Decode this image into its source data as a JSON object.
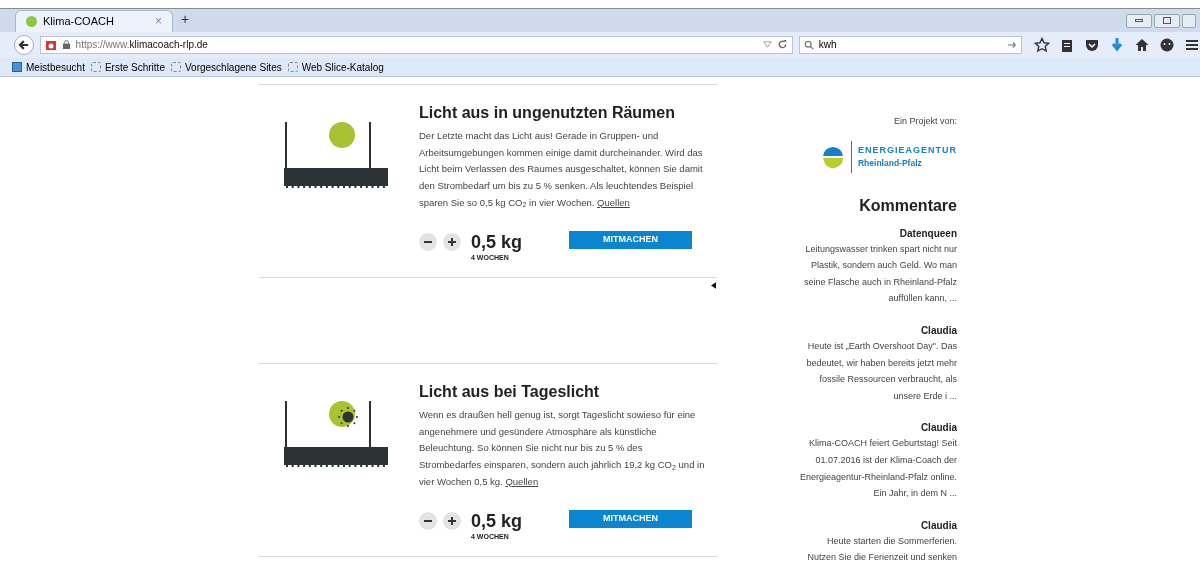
{
  "browser": {
    "tab": {
      "title": "Klima-COACH",
      "close": "×",
      "new_tab": "+"
    },
    "url": {
      "scheme": "https://www.",
      "domain": "klimacoach-rlp.de"
    },
    "search": {
      "value": "kwh"
    },
    "bookmarks": [
      {
        "label": "Meistbesucht",
        "kind": "special"
      },
      {
        "label": "Erste Schritte",
        "kind": "page"
      },
      {
        "label": "Vorgeschlagene Sites",
        "kind": "page"
      },
      {
        "label": "Web Slice-Katalog",
        "kind": "page"
      }
    ]
  },
  "cards": [
    {
      "kind": "bulb",
      "title": "Licht aus in ungenutzten Räumen",
      "body": "Der Letzte macht das Licht aus! Gerade in Gruppen- und Arbeitsumgebungen kommen einige damit durcheinander. Wird das Licht beim Verlassen des Raumes ausgeschaltet, können Sie damit den Strombedarf um bis zu 5 % senken. Als leuchtendes Beispiel sparen Sie so 0,5 kg CO$_{2}$ in vier Wochen.",
      "link": "Quellen",
      "amount": "0,5 kg",
      "period": "4 WOCHEN",
      "button": "MITMACHEN"
    },
    {
      "kind": "sun",
      "title": "Licht aus bei Tageslicht",
      "body": "Wenn es draußen hell genug ist, sorgt Tageslicht sowieso für eine angenehmere und gesündere Atmosphäre als künstliche Beleuchtung. So können Sie nicht nur bis zu 5 % des Strombedarfes einsparen, sondern auch jährlich 19,2 kg CO$_{2}$ und in vier Wochen 0,5 kg.",
      "link": "Quellen",
      "amount": "0,5 kg",
      "period": "4 WOCHEN",
      "button": "MITMACHEN"
    }
  ],
  "sidebar": {
    "project_label": "Ein Projekt von:",
    "logo": {
      "name": "ENERGIEAGENTUR",
      "region": "Rheinland-Pfalz"
    },
    "heading": "Kommentare",
    "comments": [
      {
        "author": "Datenqueen",
        "text": "Leitungswasser trinken spart nicht nur Plastik, sondern auch Geld. Wo man seine Flasche auch in Rheinland-Pfalz auffüllen kann, ..."
      },
      {
        "author": "Claudia",
        "text": "Heute ist „Earth Overshoot Day\". Das bedeutet, wir haben bereits jetzt mehr fossile Ressourcen verbraucht, als unsere Erde i ..."
      },
      {
        "author": "Claudia",
        "text": "Klima-COACH feiert Geburtstag! Seit 01.07.2016 ist der Klima-Coach der Energieagentur-Rheinland-Pfalz online. Ein Jahr, in dem N ..."
      },
      {
        "author": "Claudia",
        "text": "Heute starten die Sommerferien. Nutzen Sie die Ferienzeit und senken"
      }
    ]
  }
}
